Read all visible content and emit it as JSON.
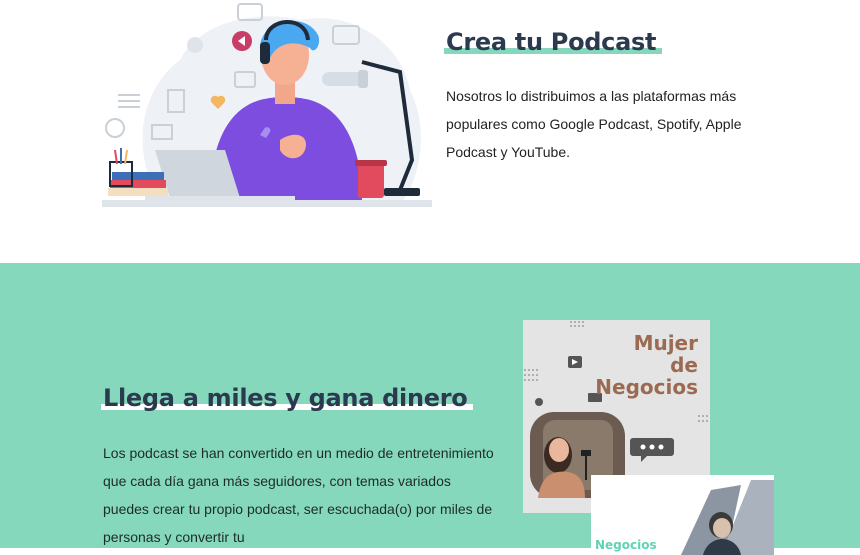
{
  "section1": {
    "title": "Crea tu Podcast",
    "paragraph": "Nosotros lo distribuimos a las plataformas más populares como Google Podcast, Spotify, Apple Podcast y YouTube."
  },
  "section2": {
    "title": "Llega a miles y gana dinero",
    "paragraph": "Los podcast se han convertido en un medio de entretenimiento que cada día gana más seguidores, con temas variados puedes crear tu propio podcast, ser escuchada(o) por miles de personas y convertir tu"
  },
  "cards": {
    "card1_title": [
      "Mujer",
      "de",
      "Negocios"
    ],
    "card2_title": "Negocios"
  },
  "colors": {
    "mint": "#85d8bb",
    "title_dark": "#2b3a4e",
    "card_brown": "#9b6a52"
  }
}
